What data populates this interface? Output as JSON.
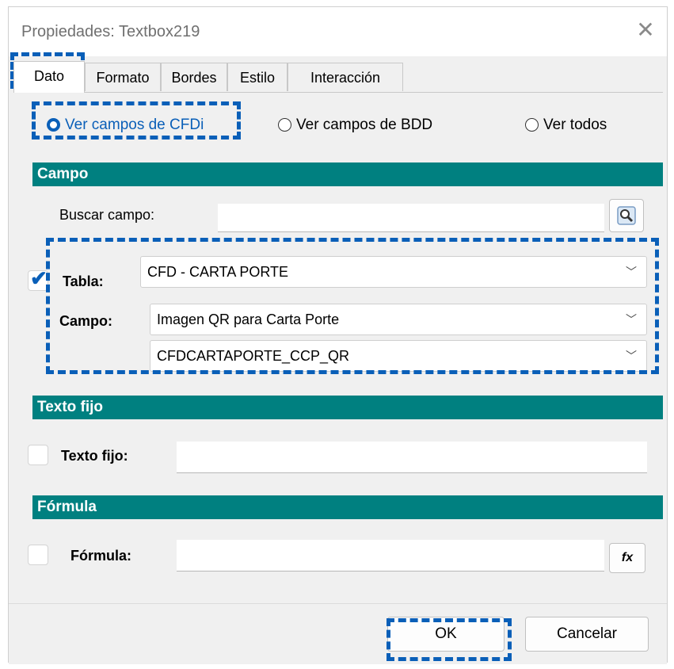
{
  "window": {
    "title": "Propiedades: Textbox219"
  },
  "tabs": [
    {
      "label": "Dato",
      "active": true
    },
    {
      "label": "Formato",
      "active": false
    },
    {
      "label": "Bordes",
      "active": false
    },
    {
      "label": "Estilo",
      "active": false
    },
    {
      "label": "Interacción",
      "active": false
    }
  ],
  "radios": [
    {
      "label": "Ver campos de CFDi",
      "checked": true
    },
    {
      "label": "Ver campos de BDD",
      "checked": false
    },
    {
      "label": "Ver todos",
      "checked": false
    }
  ],
  "campo_section": {
    "header": "Campo",
    "search_label": "Buscar campo:",
    "search_value": "",
    "search_icon": "magnifier-icon",
    "tabla_label": "Tabla:",
    "tabla_value": "CFD - CARTA PORTE",
    "tabla_checked": true,
    "campo_label": "Campo:",
    "campo_value": "Imagen QR para Carta Porte",
    "campo_code_value": "CFDCARTAPORTE_CCP_QR"
  },
  "texto_fijo_section": {
    "header": "Texto fijo",
    "label": "Texto fijo:",
    "value": "",
    "checked": false
  },
  "formula_section": {
    "header": "Fórmula",
    "label": "Fórmula:",
    "value": "",
    "checked": false,
    "fx_label": "fx"
  },
  "buttons": {
    "ok": "OK",
    "cancel": "Cancelar"
  },
  "colors": {
    "section_header": "#008080",
    "accent": "#0a5fb8",
    "annotation": "#0a5fb8"
  }
}
